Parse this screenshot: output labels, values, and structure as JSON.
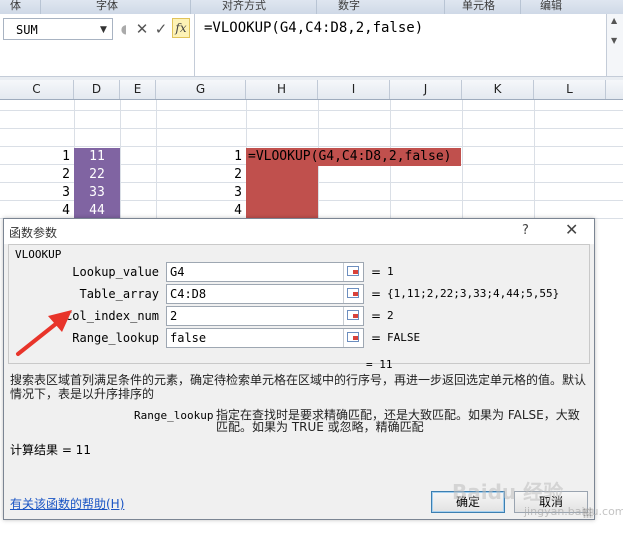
{
  "ribbon": {
    "groups": [
      "体",
      "字体",
      "对齐方式",
      "数字",
      "单元格",
      "编辑"
    ]
  },
  "formula_bar": {
    "name_box": "SUM",
    "cancel_glyph": "✕",
    "enter_glyph": "✓",
    "fx_label": "fx",
    "formula": "=VLOOKUP(G4,C4:D8,2,false)"
  },
  "sheet": {
    "columns": [
      "C",
      "D",
      "E",
      "G",
      "H",
      "I",
      "J",
      "K",
      "L"
    ],
    "col_c": [
      "1",
      "2",
      "3",
      "4"
    ],
    "col_d": [
      "11",
      "22",
      "33",
      "44"
    ],
    "col_g": [
      "1",
      "2",
      "3",
      "4"
    ],
    "h_cell_formula": "=VLOOKUP(G4,C4:D8,2,false)"
  },
  "dialog": {
    "title": "函数参数",
    "help_glyph": "?",
    "close_glyph": "✕",
    "function_name": "VLOOKUP",
    "args": [
      {
        "label": "Lookup_value",
        "value": "G4",
        "result": "1"
      },
      {
        "label": "Table_array",
        "value": "C4:D8",
        "result": "{1,11;2,22;3,33;4,44;5,55}"
      },
      {
        "label": "Col_index_num",
        "value": "2",
        "result": "2"
      },
      {
        "label": "Range_lookup",
        "value": "false",
        "result": "FALSE"
      }
    ],
    "eq": "=",
    "formula_result": "= 11",
    "description": "搜索表区域首列满足条件的元素，确定待检索单元格在区域中的行序号，再进一步返回选定单元格的值。默认情况下，表是以升序排序的",
    "param_name": "Range_lookup",
    "param_description": "指定在查找时是要求精确匹配，还是大致匹配。如果为 FALSE，大致匹配。如果为 TRUE 或忽略，精确匹配",
    "calc_result": "计算结果 = 11",
    "help_link": "有关该函数的帮助(H)",
    "ok_label": "确定",
    "cancel_label": "取消"
  },
  "watermark": {
    "text": "Baidu 经验",
    "sub": "jingyan.baidu.com"
  },
  "colors": {
    "purple_fill": "#8064a2",
    "red_fill": "#c0504d",
    "arrow": "#e8342a",
    "link": "#1a55c4"
  }
}
